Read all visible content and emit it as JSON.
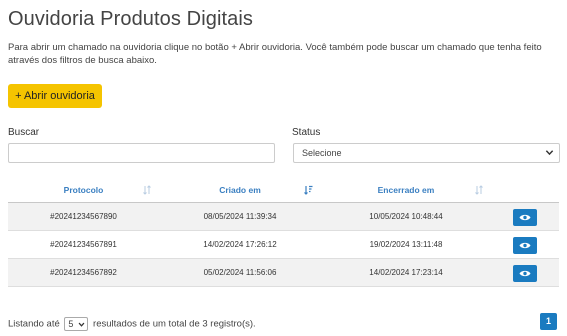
{
  "page": {
    "title": "Ouvidoria Produtos Digitais",
    "intro": "Para abrir um chamado na ouvidoria clique no botão + Abrir ouvidoria. Você também pode buscar um chamado que tenha feito através dos filtros de busca abaixo.",
    "open_button": "+ Abrir ouvidoria"
  },
  "filters": {
    "search_label": "Buscar",
    "search_value": "",
    "status_label": "Status",
    "status_selected": "Selecione"
  },
  "table": {
    "columns": [
      "Protocolo",
      "Criado em",
      "Encerrado em"
    ],
    "rows": [
      {
        "protocolo": "#20241234567890",
        "criado": "08/05/2024 11:39:34",
        "encerrado": "10/05/2024 10:48:44"
      },
      {
        "protocolo": "#20241234567891",
        "criado": "14/02/2024 17:26:12",
        "encerrado": "19/02/2024 13:11:48"
      },
      {
        "protocolo": "#20241234567892",
        "criado": "05/02/2024 11:56:06",
        "encerrado": "14/02/2024 17:23:14"
      }
    ]
  },
  "footer": {
    "prefix": "Listando até",
    "page_length": "5",
    "suffix": "resultados de um total de 3 registro(s).",
    "current_page": "1"
  },
  "colors": {
    "accent_yellow": "#f5c400",
    "header_blue": "#3a7fc1",
    "button_blue": "#1a7bc0"
  },
  "icons": {
    "sort": "sort-icon",
    "sort_active": "sort-desc-icon",
    "view": "eye-icon",
    "dropdown": "chevron-down-icon"
  }
}
